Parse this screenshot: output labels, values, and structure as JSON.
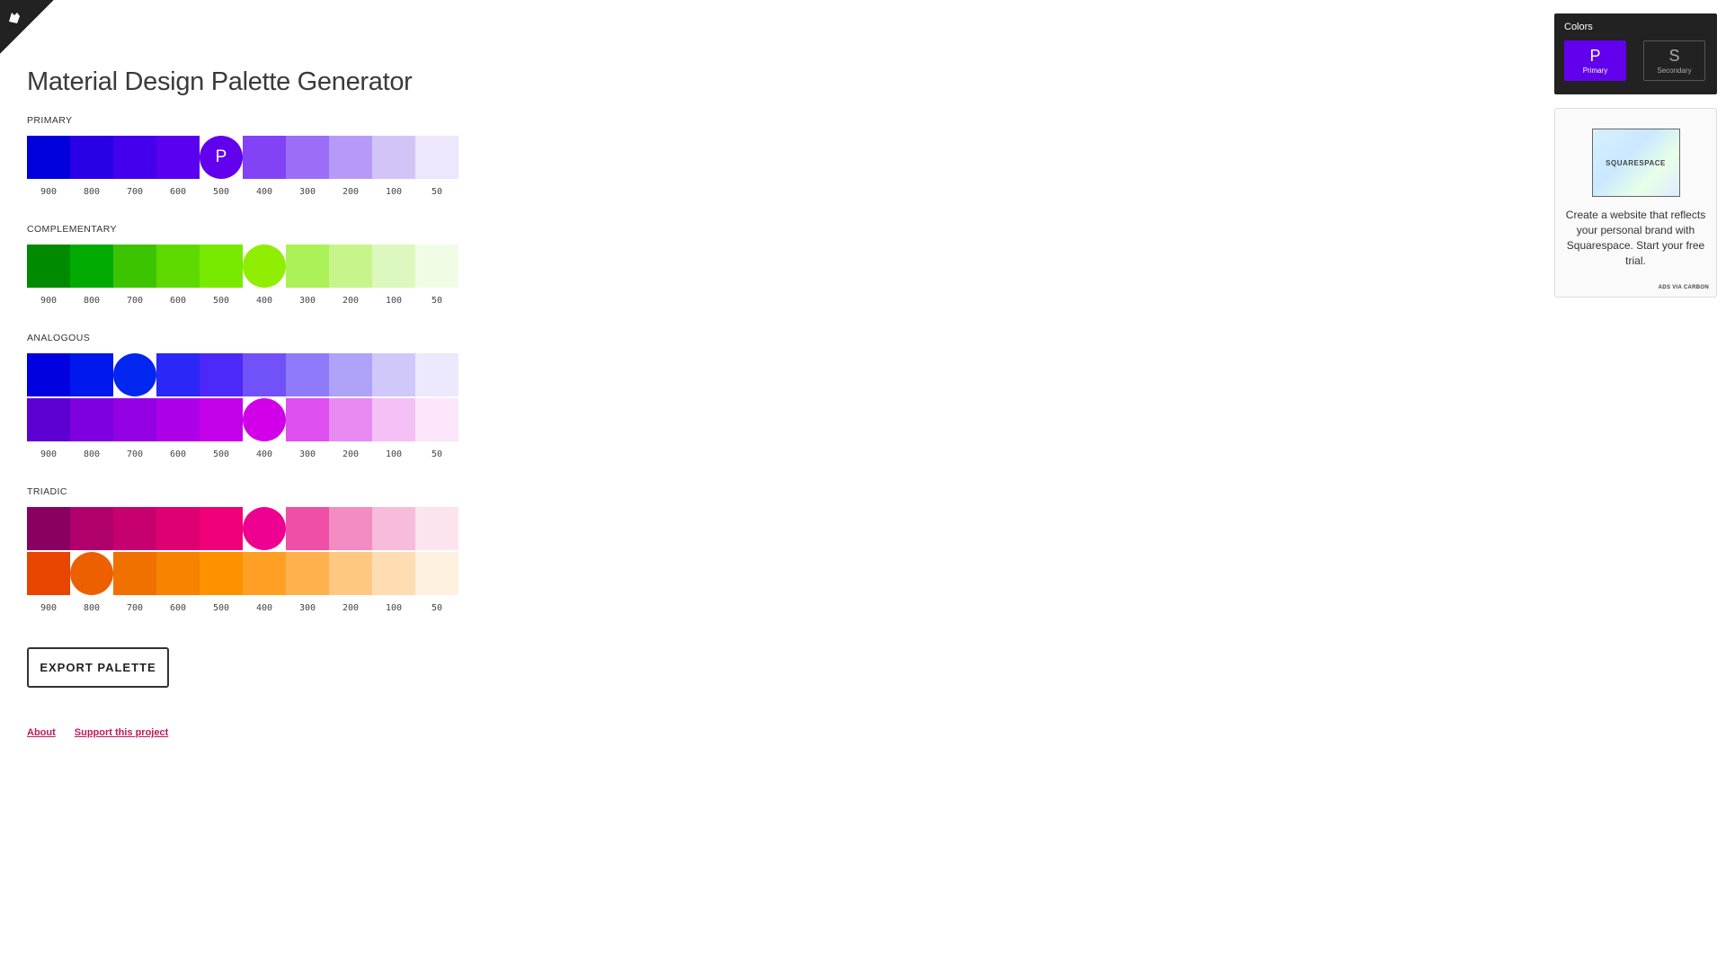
{
  "page": {
    "title": "Material Design Palette Generator"
  },
  "shade_labels": [
    "900",
    "800",
    "700",
    "600",
    "500",
    "400",
    "300",
    "200",
    "100",
    "50"
  ],
  "sections": {
    "primary": {
      "title": "PRIMARY",
      "rows": [
        {
          "colors": [
            "#0000dd",
            "#2a00e6",
            "#4400ec",
            "#5800ef",
            "#6200ee",
            "#8243f7",
            "#9c6ef8",
            "#b79af8",
            "#d3c4f8",
            "#ede6fc"
          ],
          "selected": 4,
          "label": "P"
        }
      ]
    },
    "complementary": {
      "title": "COMPLEMENTARY",
      "rows": [
        {
          "colors": [
            "#008a00",
            "#00aa00",
            "#3dc400",
            "#5dd900",
            "#77ea00",
            "#90ee02",
            "#abf157",
            "#c7f58b",
            "#ddf8be",
            "#f1fce6"
          ],
          "selected": 5,
          "label": ""
        }
      ]
    },
    "analogous": {
      "title": "ANALOGOUS",
      "rows": [
        {
          "colors": [
            "#0000e0",
            "#0018ee",
            "#0026f0",
            "#2b27f6",
            "#4c29f9",
            "#7152f9",
            "#8f7af9",
            "#aea2f9",
            "#d0c8fa",
            "#ede9fc"
          ],
          "selected": 2,
          "label": ""
        },
        {
          "colors": [
            "#5c00d4",
            "#7e00e0",
            "#9300e4",
            "#ae00e8",
            "#c300e8",
            "#d200e9",
            "#de4ff0",
            "#e98af3",
            "#f4c0f6",
            "#fbe6fb"
          ],
          "selected": 5,
          "label": ""
        }
      ]
    },
    "triadic": {
      "title": "TRIADIC",
      "rows": [
        {
          "colors": [
            "#880060",
            "#b0006b",
            "#c7006f",
            "#de0073",
            "#ef0078",
            "#ee0090",
            "#ef4fa6",
            "#f38cc2",
            "#f7bcda",
            "#fce4ee"
          ],
          "selected": 5,
          "label": ""
        },
        {
          "colors": [
            "#e74500",
            "#ed6000",
            "#f07000",
            "#f78300",
            "#fe9100",
            "#ffa025",
            "#ffb14d",
            "#ffc880",
            "#ffddb3",
            "#fff1e0"
          ],
          "selected": 1,
          "label": ""
        }
      ]
    }
  },
  "export_button": "EXPORT PALETTE",
  "links": {
    "about": "About",
    "support": "Support this project"
  },
  "picker": {
    "title": "Colors",
    "primary": {
      "letter": "P",
      "label": "Primary",
      "color": "#6200ee"
    },
    "secondary": {
      "letter": "S",
      "label": "Secondary"
    }
  },
  "ad": {
    "brand": "SQUARESPACE",
    "text": "Create a website that reflects your personal brand with Squarespace. Start your free trial.",
    "via": "ADS VIA CARBON"
  },
  "icons": {
    "corner": "github-cat-icon"
  }
}
